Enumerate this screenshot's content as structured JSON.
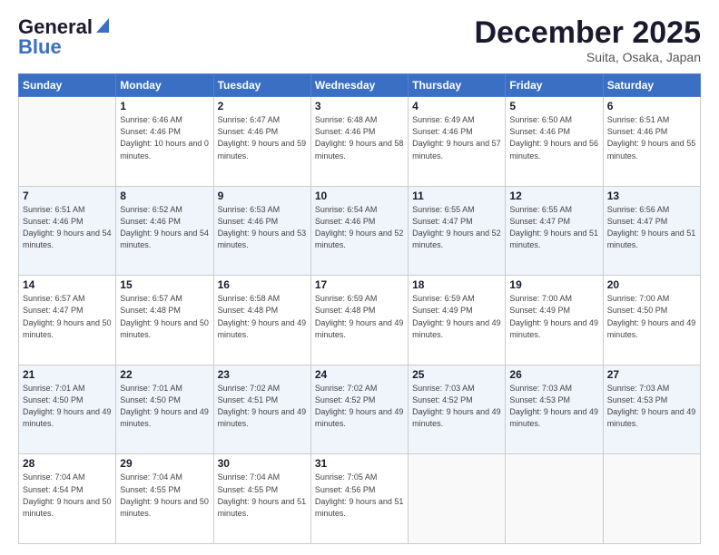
{
  "logo": {
    "line1": "General",
    "line2": "Blue"
  },
  "header": {
    "month": "December 2025",
    "location": "Suita, Osaka, Japan"
  },
  "weekdays": [
    "Sunday",
    "Monday",
    "Tuesday",
    "Wednesday",
    "Thursday",
    "Friday",
    "Saturday"
  ],
  "weeks": [
    [
      {
        "day": "",
        "empty": true
      },
      {
        "day": "1",
        "sunrise": "6:46 AM",
        "sunset": "4:46 PM",
        "daylight": "10 hours and 0 minutes."
      },
      {
        "day": "2",
        "sunrise": "6:47 AM",
        "sunset": "4:46 PM",
        "daylight": "9 hours and 59 minutes."
      },
      {
        "day": "3",
        "sunrise": "6:48 AM",
        "sunset": "4:46 PM",
        "daylight": "9 hours and 58 minutes."
      },
      {
        "day": "4",
        "sunrise": "6:49 AM",
        "sunset": "4:46 PM",
        "daylight": "9 hours and 57 minutes."
      },
      {
        "day": "5",
        "sunrise": "6:50 AM",
        "sunset": "4:46 PM",
        "daylight": "9 hours and 56 minutes."
      },
      {
        "day": "6",
        "sunrise": "6:51 AM",
        "sunset": "4:46 PM",
        "daylight": "9 hours and 55 minutes."
      }
    ],
    [
      {
        "day": "7",
        "sunrise": "6:51 AM",
        "sunset": "4:46 PM",
        "daylight": "9 hours and 54 minutes."
      },
      {
        "day": "8",
        "sunrise": "6:52 AM",
        "sunset": "4:46 PM",
        "daylight": "9 hours and 54 minutes."
      },
      {
        "day": "9",
        "sunrise": "6:53 AM",
        "sunset": "4:46 PM",
        "daylight": "9 hours and 53 minutes."
      },
      {
        "day": "10",
        "sunrise": "6:54 AM",
        "sunset": "4:46 PM",
        "daylight": "9 hours and 52 minutes."
      },
      {
        "day": "11",
        "sunrise": "6:55 AM",
        "sunset": "4:47 PM",
        "daylight": "9 hours and 52 minutes."
      },
      {
        "day": "12",
        "sunrise": "6:55 AM",
        "sunset": "4:47 PM",
        "daylight": "9 hours and 51 minutes."
      },
      {
        "day": "13",
        "sunrise": "6:56 AM",
        "sunset": "4:47 PM",
        "daylight": "9 hours and 51 minutes."
      }
    ],
    [
      {
        "day": "14",
        "sunrise": "6:57 AM",
        "sunset": "4:47 PM",
        "daylight": "9 hours and 50 minutes."
      },
      {
        "day": "15",
        "sunrise": "6:57 AM",
        "sunset": "4:48 PM",
        "daylight": "9 hours and 50 minutes."
      },
      {
        "day": "16",
        "sunrise": "6:58 AM",
        "sunset": "4:48 PM",
        "daylight": "9 hours and 49 minutes."
      },
      {
        "day": "17",
        "sunrise": "6:59 AM",
        "sunset": "4:48 PM",
        "daylight": "9 hours and 49 minutes."
      },
      {
        "day": "18",
        "sunrise": "6:59 AM",
        "sunset": "4:49 PM",
        "daylight": "9 hours and 49 minutes."
      },
      {
        "day": "19",
        "sunrise": "7:00 AM",
        "sunset": "4:49 PM",
        "daylight": "9 hours and 49 minutes."
      },
      {
        "day": "20",
        "sunrise": "7:00 AM",
        "sunset": "4:50 PM",
        "daylight": "9 hours and 49 minutes."
      }
    ],
    [
      {
        "day": "21",
        "sunrise": "7:01 AM",
        "sunset": "4:50 PM",
        "daylight": "9 hours and 49 minutes."
      },
      {
        "day": "22",
        "sunrise": "7:01 AM",
        "sunset": "4:50 PM",
        "daylight": "9 hours and 49 minutes."
      },
      {
        "day": "23",
        "sunrise": "7:02 AM",
        "sunset": "4:51 PM",
        "daylight": "9 hours and 49 minutes."
      },
      {
        "day": "24",
        "sunrise": "7:02 AM",
        "sunset": "4:52 PM",
        "daylight": "9 hours and 49 minutes."
      },
      {
        "day": "25",
        "sunrise": "7:03 AM",
        "sunset": "4:52 PM",
        "daylight": "9 hours and 49 minutes."
      },
      {
        "day": "26",
        "sunrise": "7:03 AM",
        "sunset": "4:53 PM",
        "daylight": "9 hours and 49 minutes."
      },
      {
        "day": "27",
        "sunrise": "7:03 AM",
        "sunset": "4:53 PM",
        "daylight": "9 hours and 49 minutes."
      }
    ],
    [
      {
        "day": "28",
        "sunrise": "7:04 AM",
        "sunset": "4:54 PM",
        "daylight": "9 hours and 50 minutes."
      },
      {
        "day": "29",
        "sunrise": "7:04 AM",
        "sunset": "4:55 PM",
        "daylight": "9 hours and 50 minutes."
      },
      {
        "day": "30",
        "sunrise": "7:04 AM",
        "sunset": "4:55 PM",
        "daylight": "9 hours and 51 minutes."
      },
      {
        "day": "31",
        "sunrise": "7:05 AM",
        "sunset": "4:56 PM",
        "daylight": "9 hours and 51 minutes."
      },
      {
        "day": "",
        "empty": true
      },
      {
        "day": "",
        "empty": true
      },
      {
        "day": "",
        "empty": true
      }
    ]
  ]
}
